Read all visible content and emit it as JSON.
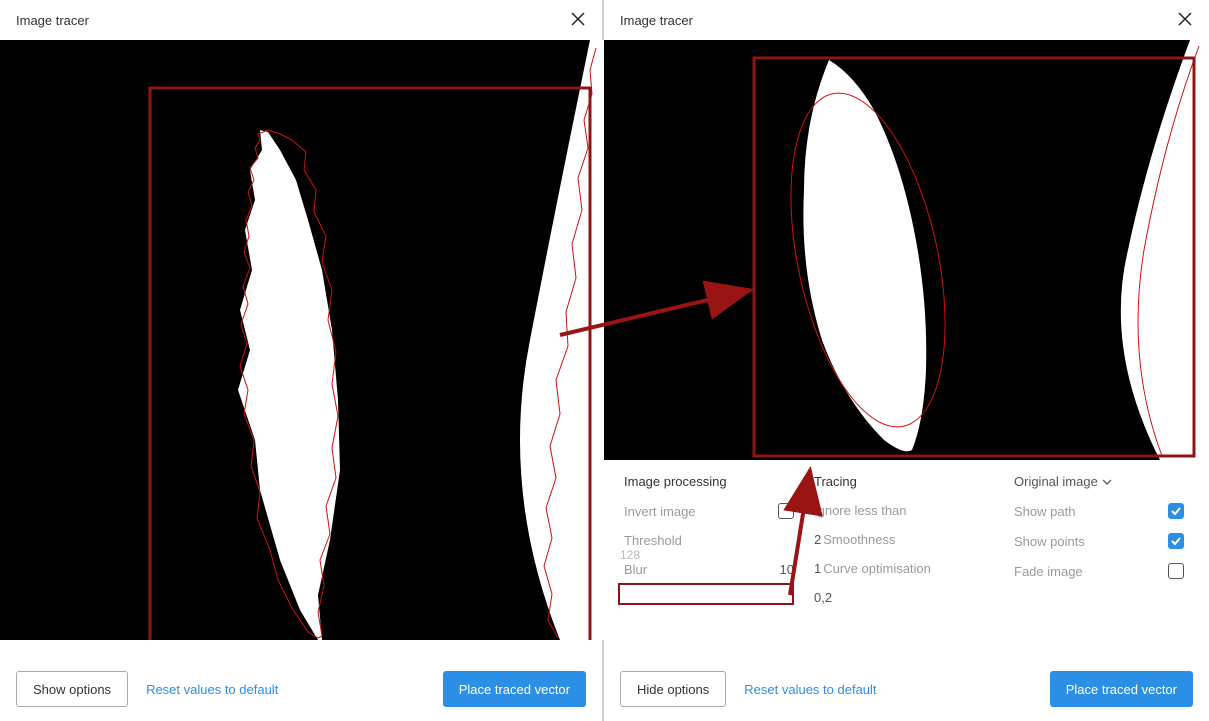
{
  "left": {
    "title": "Image tracer",
    "show_options_label": "Show options",
    "reset_label": "Reset values to default",
    "place_label": "Place traced vector"
  },
  "right": {
    "title": "Image tracer",
    "hide_options_label": "Hide options",
    "reset_label": "Reset values to default",
    "place_label": "Place traced vector",
    "image_processing_title": "Image processing",
    "tracing_title": "Tracing",
    "dropdown_label": "Original image",
    "invert_label": "Invert image",
    "threshold_label": "Threshold",
    "threshold_left_value": "128",
    "blur_label": "Blur",
    "blur_value": "10",
    "ignore_label": "Ignore less than",
    "ignore_value": "2",
    "smoothness_label": "Smoothness",
    "smoothness_value": "1",
    "curveopt_label": "Curve optimisation",
    "curveopt_value": "0,2",
    "showpath_label": "Show path",
    "showpoints_label": "Show points",
    "fade_label": "Fade image"
  }
}
